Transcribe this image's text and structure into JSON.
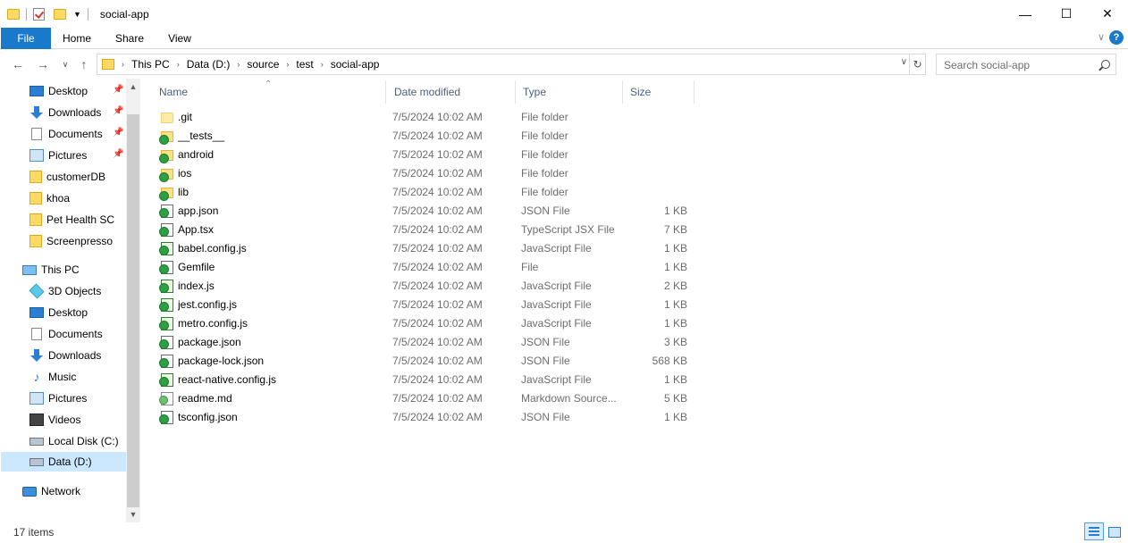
{
  "window": {
    "title": "social-app",
    "minimize_glyph": "—",
    "maximize_glyph": "☐",
    "close_glyph": "✕"
  },
  "ribbon": {
    "tabs": [
      "File",
      "Home",
      "Share",
      "View"
    ],
    "help_glyph": "?"
  },
  "address": {
    "breadcrumbs": [
      "This PC",
      "Data (D:)",
      "source",
      "test",
      "social-app"
    ],
    "search_placeholder": "Search social-app"
  },
  "sidebar": {
    "quick_access": [
      {
        "label": "Desktop",
        "icon": "desktop-icon",
        "pinned": true
      },
      {
        "label": "Downloads",
        "icon": "downloads-icon",
        "pinned": true
      },
      {
        "label": "Documents",
        "icon": "documents-icon",
        "pinned": true
      },
      {
        "label": "Pictures",
        "icon": "pictures-icon",
        "pinned": true
      },
      {
        "label": "customerDB",
        "icon": "folder-icon",
        "pinned": false
      },
      {
        "label": "khoa",
        "icon": "folder-icon",
        "pinned": false
      },
      {
        "label": "Pet Health SC",
        "icon": "folder-icon",
        "pinned": false
      },
      {
        "label": "Screenpresso",
        "icon": "folder-icon",
        "pinned": false
      }
    ],
    "this_pc": "This PC",
    "pc_items": [
      {
        "label": "3D Objects",
        "icon": "3d-objects-icon"
      },
      {
        "label": "Desktop",
        "icon": "desktop-icon"
      },
      {
        "label": "Documents",
        "icon": "documents-icon"
      },
      {
        "label": "Downloads",
        "icon": "downloads-icon"
      },
      {
        "label": "Music",
        "icon": "music-icon"
      },
      {
        "label": "Pictures",
        "icon": "pictures-icon"
      },
      {
        "label": "Videos",
        "icon": "videos-icon"
      },
      {
        "label": "Local Disk (C:)",
        "icon": "local-disk-icon"
      },
      {
        "label": "Data (D:)",
        "icon": "data-drive-icon",
        "selected": true
      }
    ],
    "network": "Network"
  },
  "columns": {
    "name": "Name",
    "date": "Date modified",
    "type": "Type",
    "size": "Size"
  },
  "files": [
    {
      "name": ".git",
      "date": "7/5/2024 10:02 AM",
      "type": "File folder",
      "size": "",
      "icon": "git-folder-icon"
    },
    {
      "name": "__tests__",
      "date": "7/5/2024 10:02 AM",
      "type": "File folder",
      "size": "",
      "icon": "synced-folder-icon"
    },
    {
      "name": "android",
      "date": "7/5/2024 10:02 AM",
      "type": "File folder",
      "size": "",
      "icon": "synced-folder-icon"
    },
    {
      "name": "ios",
      "date": "7/5/2024 10:02 AM",
      "type": "File folder",
      "size": "",
      "icon": "synced-folder-icon"
    },
    {
      "name": "lib",
      "date": "7/5/2024 10:02 AM",
      "type": "File folder",
      "size": "",
      "icon": "synced-folder-icon"
    },
    {
      "name": "app.json",
      "date": "7/5/2024 10:02 AM",
      "type": "JSON File",
      "size": "1 KB",
      "icon": "json-file-icon"
    },
    {
      "name": "App.tsx",
      "date": "7/5/2024 10:02 AM",
      "type": "TypeScript JSX File",
      "size": "7 KB",
      "icon": "tsx-file-icon"
    },
    {
      "name": "babel.config.js",
      "date": "7/5/2024 10:02 AM",
      "type": "JavaScript File",
      "size": "1 KB",
      "icon": "js-file-icon"
    },
    {
      "name": "Gemfile",
      "date": "7/5/2024 10:02 AM",
      "type": "File",
      "size": "1 KB",
      "icon": "file-icon"
    },
    {
      "name": "index.js",
      "date": "7/5/2024 10:02 AM",
      "type": "JavaScript File",
      "size": "2 KB",
      "icon": "js-file-icon"
    },
    {
      "name": "jest.config.js",
      "date": "7/5/2024 10:02 AM",
      "type": "JavaScript File",
      "size": "1 KB",
      "icon": "js-file-icon"
    },
    {
      "name": "metro.config.js",
      "date": "7/5/2024 10:02 AM",
      "type": "JavaScript File",
      "size": "1 KB",
      "icon": "js-file-icon"
    },
    {
      "name": "package.json",
      "date": "7/5/2024 10:02 AM",
      "type": "JSON File",
      "size": "3 KB",
      "icon": "json-file-icon"
    },
    {
      "name": "package-lock.json",
      "date": "7/5/2024 10:02 AM",
      "type": "JSON File",
      "size": "568 KB",
      "icon": "json-file-icon"
    },
    {
      "name": "react-native.config.js",
      "date": "7/5/2024 10:02 AM",
      "type": "JavaScript File",
      "size": "1 KB",
      "icon": "js-file-icon"
    },
    {
      "name": "readme.md",
      "date": "7/5/2024 10:02 AM",
      "type": "Markdown Source...",
      "size": "5 KB",
      "icon": "markdown-file-icon"
    },
    {
      "name": "tsconfig.json",
      "date": "7/5/2024 10:02 AM",
      "type": "JSON File",
      "size": "1 KB",
      "icon": "json-file-icon"
    }
  ],
  "status": {
    "item_count": "17 items"
  },
  "colors": {
    "accent": "#1979ca",
    "selection": "#cce8ff",
    "folder": "#ffe083"
  }
}
